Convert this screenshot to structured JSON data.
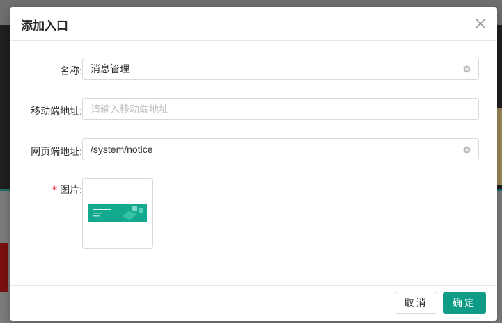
{
  "modal": {
    "title": "添加入口",
    "close_icon": "close-icon"
  },
  "form": {
    "name": {
      "label": "名称:",
      "value": "消息管理",
      "placeholder": ""
    },
    "mobile_url": {
      "label": "移动端地址:",
      "value": "",
      "placeholder": "请输入移动端地址"
    },
    "web_url": {
      "label": "网页端地址:",
      "value": "/system/notice",
      "placeholder": ""
    },
    "image": {
      "required_mark": "*",
      "label": "图片:"
    }
  },
  "footer": {
    "cancel_label": "取消",
    "ok_label": "确定"
  },
  "colors": {
    "primary": "#0f9c86",
    "required": "#f5222d"
  }
}
